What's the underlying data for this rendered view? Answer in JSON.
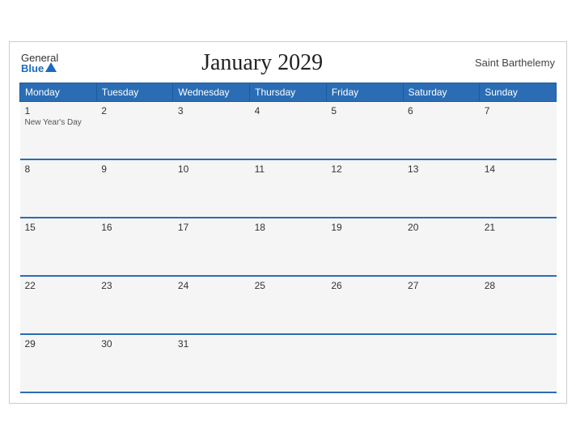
{
  "header": {
    "logo_general": "General",
    "logo_blue": "Blue",
    "title": "January 2029",
    "region": "Saint Barthelemy"
  },
  "days_of_week": [
    "Monday",
    "Tuesday",
    "Wednesday",
    "Thursday",
    "Friday",
    "Saturday",
    "Sunday"
  ],
  "weeks": [
    [
      {
        "day": "1",
        "event": "New Year's Day"
      },
      {
        "day": "2",
        "event": ""
      },
      {
        "day": "3",
        "event": ""
      },
      {
        "day": "4",
        "event": ""
      },
      {
        "day": "5",
        "event": ""
      },
      {
        "day": "6",
        "event": ""
      },
      {
        "day": "7",
        "event": ""
      }
    ],
    [
      {
        "day": "8",
        "event": ""
      },
      {
        "day": "9",
        "event": ""
      },
      {
        "day": "10",
        "event": ""
      },
      {
        "day": "11",
        "event": ""
      },
      {
        "day": "12",
        "event": ""
      },
      {
        "day": "13",
        "event": ""
      },
      {
        "day": "14",
        "event": ""
      }
    ],
    [
      {
        "day": "15",
        "event": ""
      },
      {
        "day": "16",
        "event": ""
      },
      {
        "day": "17",
        "event": ""
      },
      {
        "day": "18",
        "event": ""
      },
      {
        "day": "19",
        "event": ""
      },
      {
        "day": "20",
        "event": ""
      },
      {
        "day": "21",
        "event": ""
      }
    ],
    [
      {
        "day": "22",
        "event": ""
      },
      {
        "day": "23",
        "event": ""
      },
      {
        "day": "24",
        "event": ""
      },
      {
        "day": "25",
        "event": ""
      },
      {
        "day": "26",
        "event": ""
      },
      {
        "day": "27",
        "event": ""
      },
      {
        "day": "28",
        "event": ""
      }
    ],
    [
      {
        "day": "29",
        "event": ""
      },
      {
        "day": "30",
        "event": ""
      },
      {
        "day": "31",
        "event": ""
      },
      {
        "day": "",
        "event": ""
      },
      {
        "day": "",
        "event": ""
      },
      {
        "day": "",
        "event": ""
      },
      {
        "day": "",
        "event": ""
      }
    ]
  ]
}
